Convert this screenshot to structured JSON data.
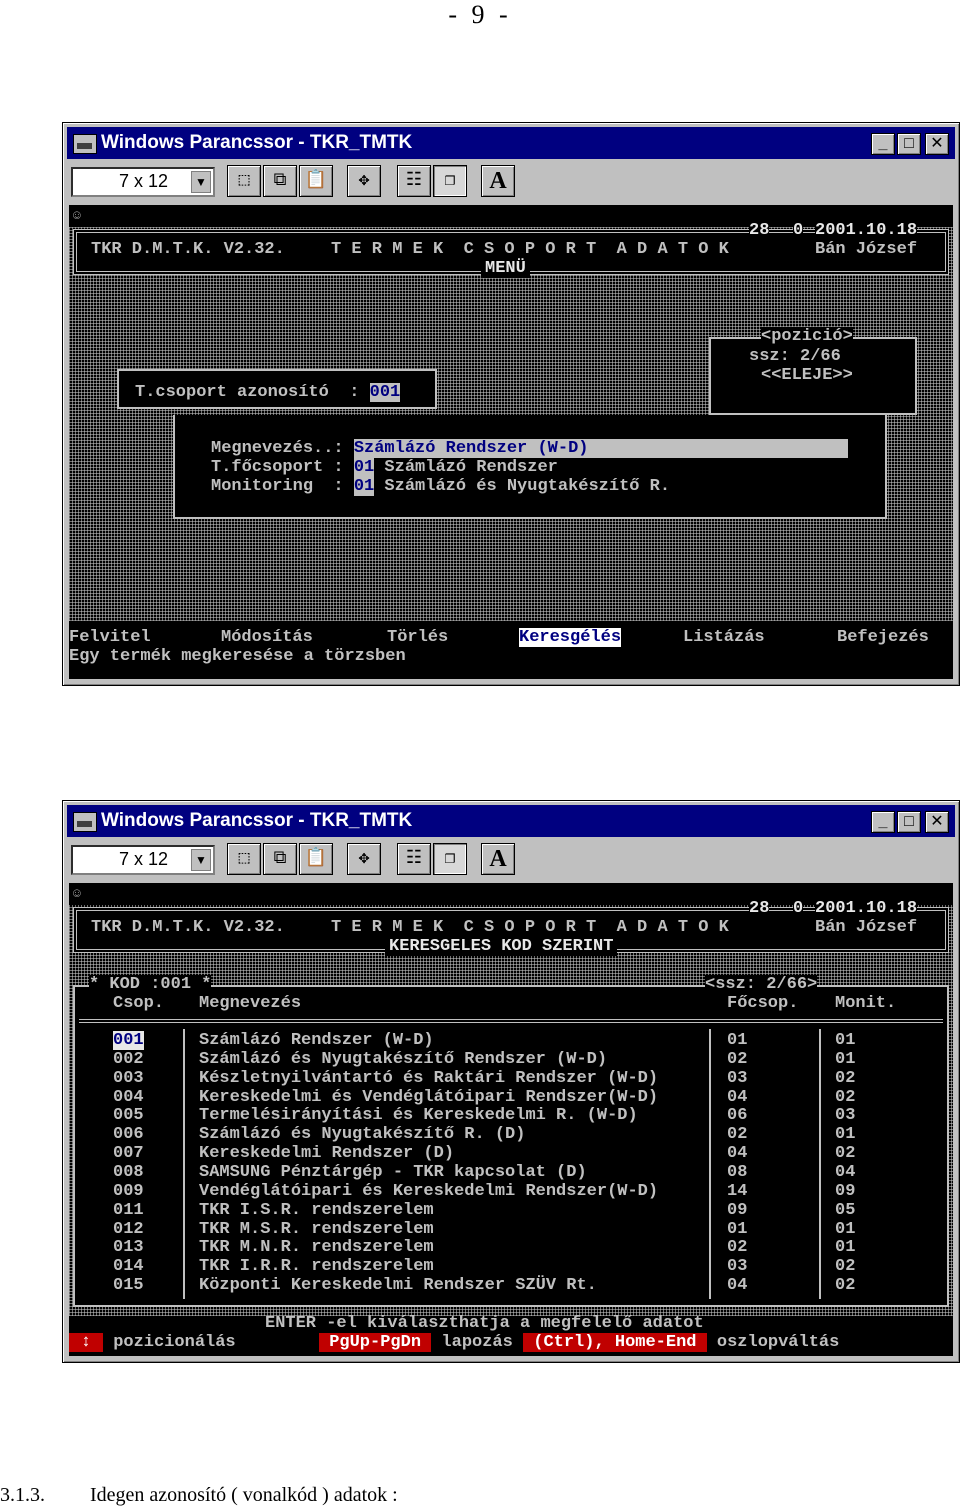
{
  "page_number": "- 9 -",
  "caption": {
    "number": "3.1.3.",
    "text": "Idegen azonosító ( vonalkód ) adatok :"
  },
  "window_title": "Windows Parancssor - TKR_TMTK",
  "font_size": "7 x 12",
  "toolbar_icons": [
    "mark-icon",
    "copy-icon",
    "paste-icon",
    "fullscreen-icon",
    "properties-icon",
    "background-icon",
    "font-icon"
  ],
  "header": {
    "counter": "28",
    "slot": "0",
    "date": "2001.10.18",
    "app": "TKR D.M.T.K. V2.32.",
    "module": "T E R M E K  C S O P O R T  A D A T O K",
    "user": "Bán József"
  },
  "screen1": {
    "subtitle": "MENÜ",
    "position_label": "<pozició>",
    "ssz": "ssz: 2/66",
    "eleje": "<<ELEJE>>",
    "group_id_label": "T.csoport azonosító  : ",
    "group_id_value": "001",
    "name_label": "Megnevezés..: ",
    "name_value": "Számlázó Rendszer (W-D)",
    "main_group_label": "T.főcsoport : ",
    "main_group_code": "01",
    "main_group_name": " Számlázó Rendszer",
    "monitoring_label": "Monitoring  : ",
    "monitoring_code": "01",
    "monitoring_name": " Számlázó és Nyugtakészítő R.",
    "menu": [
      "Felvitel",
      "Módosítás",
      "Törlés",
      "Keresgélés",
      "Listázás",
      "Befejezés"
    ],
    "menu_selected": "Keresgélés",
    "help": "Egy termék megkeresése a törzsben"
  },
  "screen2": {
    "subtitle": "KERESGELES KOD SZERINT",
    "kod": "* KOD :001 *",
    "ssz": "<ssz: 2/66>",
    "columns": [
      "Csop.",
      "Megnevezés",
      "Főcsop.",
      "Monit."
    ],
    "rows": [
      [
        "001",
        "Számlázó Rendszer (W-D)",
        "01",
        "01"
      ],
      [
        "002",
        "Számlázó és Nyugtakészítő Rendszer (W-D)",
        "02",
        "01"
      ],
      [
        "003",
        "Készletnyilvántartó és Raktári Rendszer (W-D)",
        "03",
        "02"
      ],
      [
        "004",
        "Kereskedelmi és Vendéglátóipari Rendszer(W-D)",
        "04",
        "02"
      ],
      [
        "005",
        "Termelésirányítási és Kereskedelmi R. (W-D)",
        "06",
        "03"
      ],
      [
        "006",
        "Számlázó és Nyugtakészítő R. (D)",
        "02",
        "01"
      ],
      [
        "007",
        "Kereskedelmi Rendszer (D)",
        "04",
        "02"
      ],
      [
        "008",
        "SAMSUNG Pénztárgép - TKR kapcsolat (D)",
        "08",
        "04"
      ],
      [
        "009",
        "Vendéglátóipari és Kereskedelmi Rendszer(W-D)",
        "14",
        "09"
      ],
      [
        "011",
        "TKR I.S.R. rendszerelem",
        "09",
        "05"
      ],
      [
        "012",
        "TKR M.S.R. rendszerelem",
        "01",
        "01"
      ],
      [
        "013",
        "TKR M.N.R. rendszerelem",
        "02",
        "01"
      ],
      [
        "014",
        "TKR I.R.R. rendszerelem",
        "03",
        "02"
      ],
      [
        "015",
        "Központi Kereskedelmi Rendszer SZÜV Rt.",
        "04",
        "02"
      ]
    ],
    "footer_line1": "ENTER -el kiválaszthatja a megfelelő adatot",
    "footer_arrow": "↕",
    "footer_pos": " pozicionálás ",
    "footer_pg": " PgUp-PgDn ",
    "footer_lap": " lapozás ",
    "footer_ctrl": " (Ctrl), Home-End ",
    "footer_col": " oszlopváltás"
  }
}
